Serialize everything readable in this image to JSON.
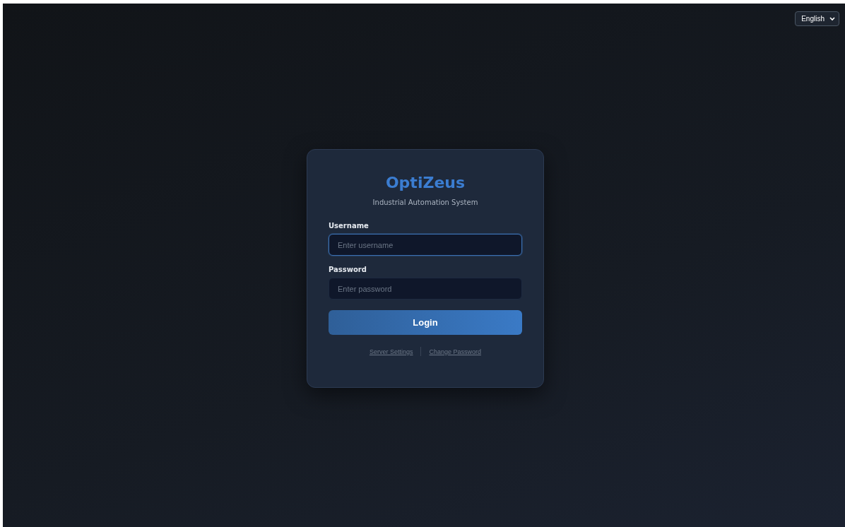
{
  "language_select": {
    "value": "English"
  },
  "login_card": {
    "title": "OptiZeus",
    "subtitle": "Industrial Automation System",
    "fields": [
      {
        "label": "Username",
        "placeholder": "Enter username",
        "focused": true
      },
      {
        "label": "Password",
        "placeholder": "Enter password",
        "focused": false
      }
    ],
    "submit_button": "Login",
    "links": [
      "Server Settings",
      "Change Password"
    ]
  }
}
